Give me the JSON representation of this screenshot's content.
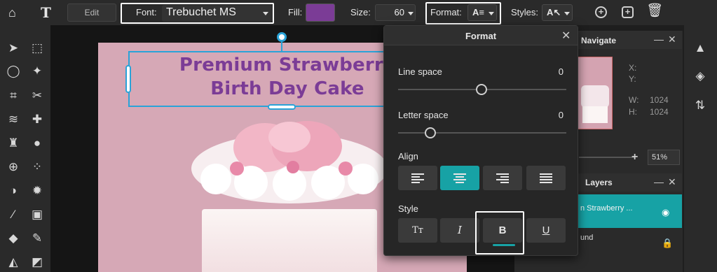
{
  "toolbar": {
    "edit_label": "Edit",
    "font_label": "Font:",
    "font_value": "Trebuchet MS",
    "fill_label": "Fill:",
    "fill_color": "#7b3c96",
    "size_label": "Size:",
    "size_value": "60",
    "format_label": "Format:",
    "styles_label": "Styles:",
    "icons": [
      "home-icon",
      "text-tool-icon",
      "format-icon",
      "styles-icon",
      "add-layer-icon",
      "duplicate-layer-icon",
      "delete-icon"
    ]
  },
  "canvas": {
    "text_line1": "Premium Strawberry",
    "text_line2": "Birth Day Cake",
    "text_color": "#7b3c96"
  },
  "format_panel": {
    "title": "Format",
    "close": "✕",
    "line_space_label": "Line space",
    "line_space_value": "0",
    "letter_space_label": "Letter space",
    "letter_space_value": "0",
    "align_label": "Align",
    "align_selected": "center",
    "style_label": "Style",
    "style_buttons": [
      "Tт",
      "I",
      "B",
      "U"
    ],
    "style_selected": "bold",
    "accent": "#17a2a5"
  },
  "navigate": {
    "title": "Navigate",
    "x_label": "X:",
    "y_label": "Y:",
    "w_label": "W:",
    "w_value": "1024",
    "h_label": "H:",
    "h_value": "1024",
    "zoom_value": "51%"
  },
  "layers": {
    "title": "Layers",
    "items": [
      {
        "label": "n Strawberry ...",
        "active": true
      },
      {
        "label": "und",
        "active": false
      }
    ]
  }
}
